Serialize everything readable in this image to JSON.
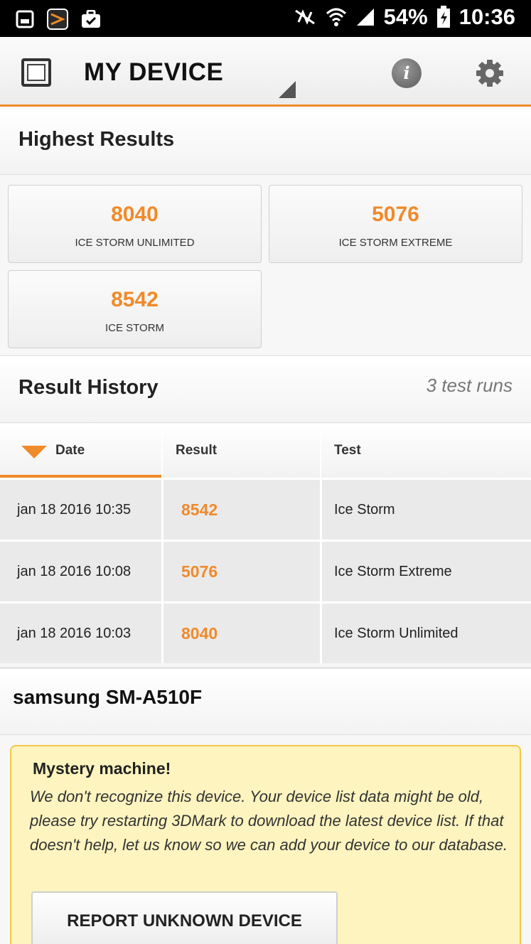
{
  "status_bar": {
    "battery": "54%",
    "time": "10:36"
  },
  "app_bar": {
    "title": "MY DEVICE"
  },
  "highest_results": {
    "title": "Highest Results",
    "tiles": [
      {
        "score": "8040",
        "name": "ICE STORM UNLIMITED"
      },
      {
        "score": "5076",
        "name": "ICE STORM EXTREME"
      },
      {
        "score": "8542",
        "name": "ICE STORM"
      }
    ]
  },
  "result_history": {
    "title": "Result History",
    "count": "3 test runs",
    "columns": {
      "date": "Date",
      "result": "Result",
      "test": "Test"
    },
    "rows": [
      {
        "date": "jan 18 2016 10:35",
        "result": "8542",
        "test": "Ice Storm"
      },
      {
        "date": "jan 18 2016 10:08",
        "result": "5076",
        "test": "Ice Storm Extreme"
      },
      {
        "date": "jan 18 2016 10:03",
        "result": "8040",
        "test": "Ice Storm Unlimited"
      }
    ]
  },
  "device": {
    "name": "samsung SM-A510F"
  },
  "notice": {
    "title": "Mystery machine!",
    "body": "We don't recognize this device. Your device list data might be old, please try restarting 3DMark to download the latest device list. If that doesn't help, let us know so we can add your device to our database.",
    "button": "REPORT UNKNOWN DEVICE"
  },
  "colors": {
    "accent": "#f08a2a",
    "notice_bg": "#fdf4bf"
  }
}
